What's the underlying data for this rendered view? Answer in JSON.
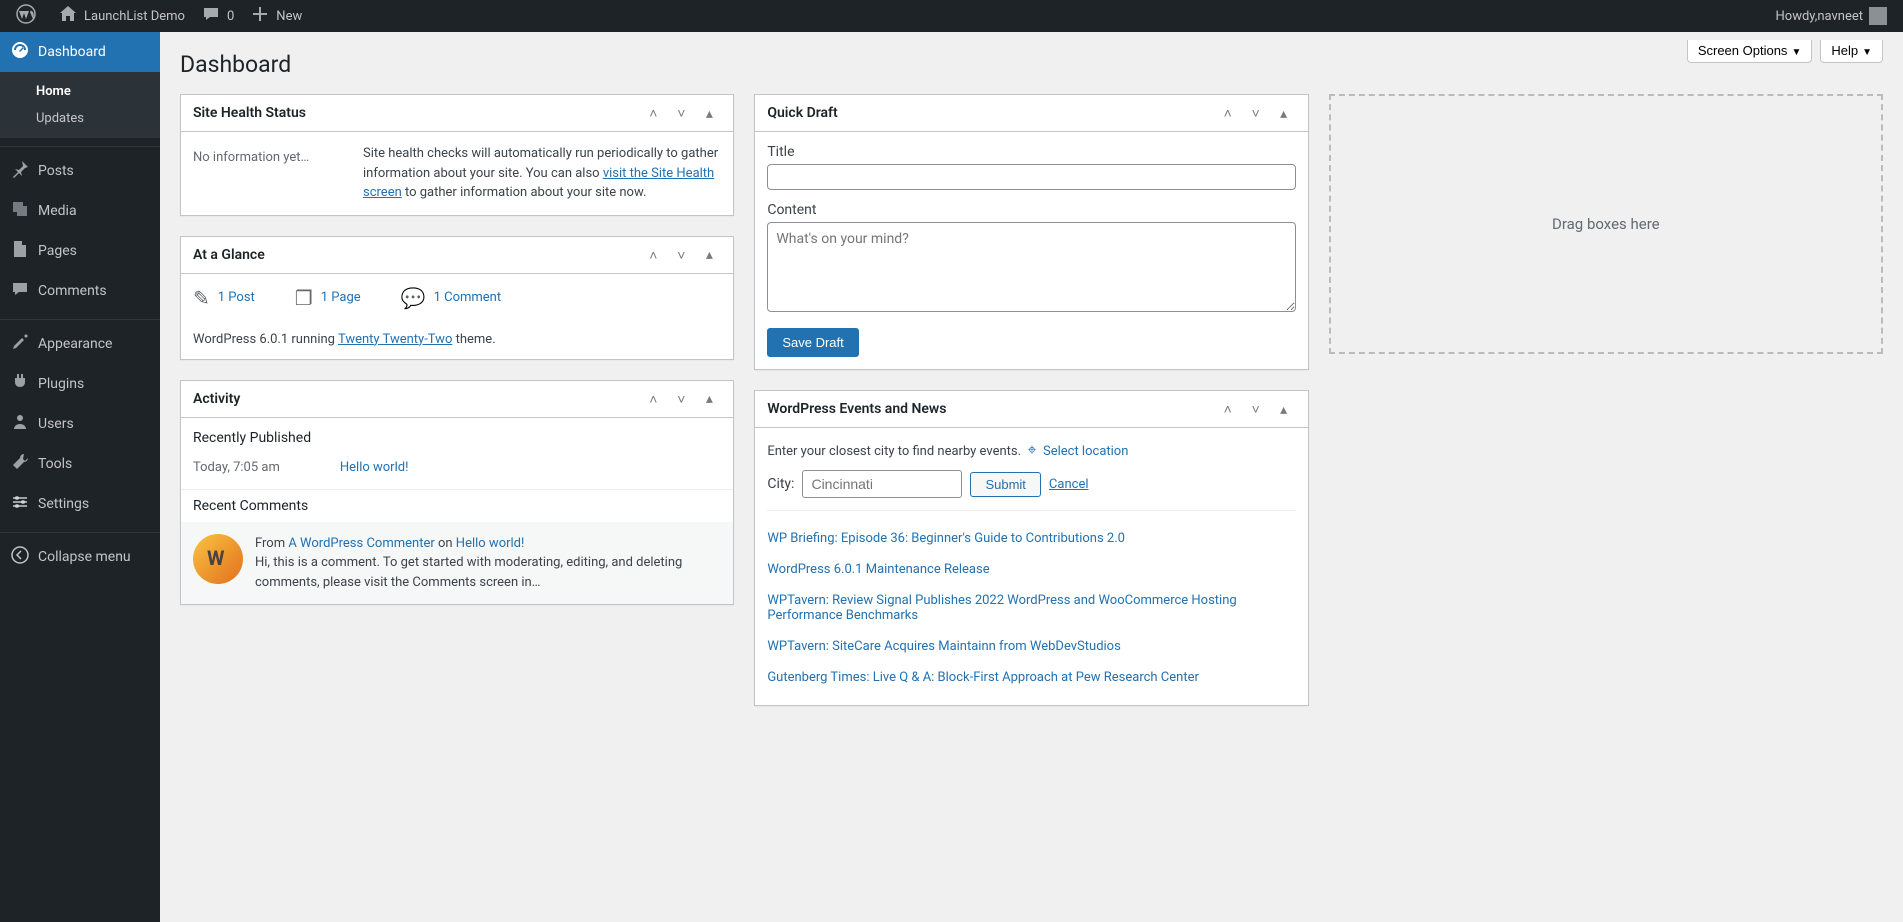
{
  "adminbar": {
    "site_name": "LaunchList Demo",
    "comments_count": "0",
    "new_label": "New",
    "howdy_prefix": "Howdy, ",
    "user_name": "navneet"
  },
  "adminmenu": {
    "dashboard": "Dashboard",
    "dashboard_sub": {
      "home": "Home",
      "updates": "Updates"
    },
    "posts": "Posts",
    "media": "Media",
    "pages": "Pages",
    "comments": "Comments",
    "appearance": "Appearance",
    "plugins": "Plugins",
    "users": "Users",
    "tools": "Tools",
    "settings": "Settings",
    "collapse": "Collapse menu"
  },
  "header": {
    "screen_options": "Screen Options",
    "help": "Help",
    "page_title": "Dashboard"
  },
  "site_health": {
    "title": "Site Health Status",
    "no_info": "No information yet…",
    "p1": "Site health checks will automatically run periodically to gather information about your site. You can also ",
    "link": "visit the Site Health screen",
    "p2": " to gather information about your site now."
  },
  "glance": {
    "title": "At a Glance",
    "post": "1 Post",
    "page": "1 Page",
    "comment": "1 Comment",
    "running_pre": "WordPress 6.0.1 running ",
    "theme": "Twenty Twenty-Two",
    "running_post": " theme."
  },
  "activity": {
    "title": "Activity",
    "recently_published": "Recently Published",
    "pub_time": "Today, 7:05 am",
    "pub_title": "Hello world!",
    "recent_comments": "Recent Comments",
    "from": "From ",
    "commenter": "A WordPress Commenter",
    "on": " on ",
    "on_post": "Hello world!",
    "comment_body": "Hi, this is a comment. To get started with moderating, editing, and deleting comments, please visit the Comments screen in…"
  },
  "quickdraft": {
    "title": "Quick Draft",
    "title_label": "Title",
    "content_label": "Content",
    "placeholder": "What's on your mind?",
    "save": "Save Draft"
  },
  "news": {
    "title": "WordPress Events and News",
    "find_prompt": "Enter your closest city to find nearby events.",
    "select_location": "Select location",
    "city_label": "City:",
    "city_placeholder": "Cincinnati",
    "submit": "Submit",
    "cancel": "Cancel",
    "items": {
      "0": "WP Briefing: Episode 36: Beginner's Guide to Contributions 2.0",
      "1": "WordPress 6.0.1 Maintenance Release",
      "2": "WPTavern: Review Signal Publishes 2022 WordPress and WooCommerce Hosting Performance Benchmarks",
      "3": "WPTavern: SiteCare Acquires Maintainn from WebDevStudios",
      "4": "Gutenberg Times: Live Q & A: Block-First Approach at Pew Research Center"
    }
  },
  "dropzone": "Drag boxes here"
}
